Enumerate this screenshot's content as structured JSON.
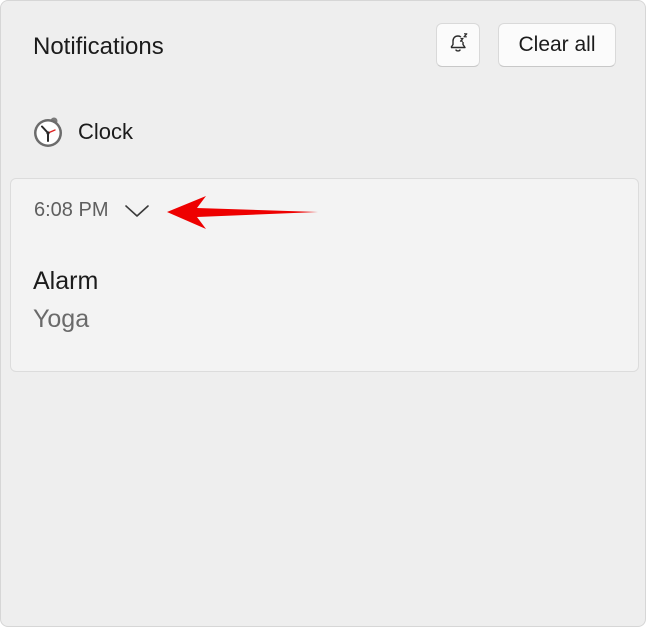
{
  "header": {
    "title": "Notifications",
    "dnd_icon": "bell-snooze-icon",
    "clear_all_label": "Clear all"
  },
  "app_group": {
    "app_name": "Clock",
    "app_icon": "clock-icon"
  },
  "notification": {
    "time": "6:08 PM",
    "expand_icon": "chevron-down-icon",
    "title": "Alarm",
    "body": "Yoga"
  },
  "annotation": {
    "icon": "red-arrow-annotation",
    "color": "#ee0000"
  },
  "colors": {
    "panel_bg": "#eeeeee",
    "card_bg": "#f3f3f3",
    "button_bg": "#fbfbfb"
  }
}
